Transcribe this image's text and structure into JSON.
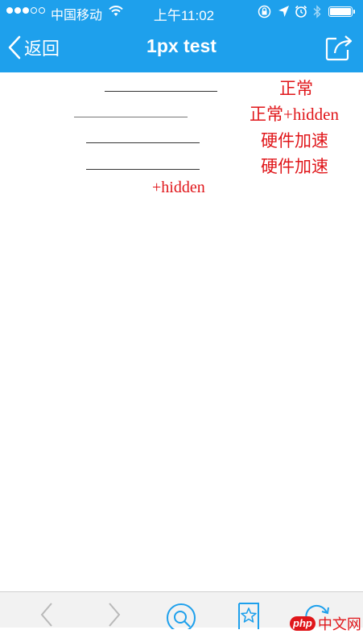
{
  "status_bar": {
    "carrier": "中国移动",
    "time": "上午11:02"
  },
  "nav": {
    "back_label": "返回",
    "title": "1px test"
  },
  "content": {
    "labels": [
      "正常",
      "正常+hidden",
      "硬件加速",
      "硬件加速",
      "+hidden"
    ]
  },
  "watermark": {
    "badge": "php",
    "text": "中文网"
  },
  "colors": {
    "header": "#1ea0ec",
    "label_red": "#e0161a",
    "toolbar_icon_blue": "#1ea0ec"
  },
  "icons": {
    "status": [
      "signal-dots",
      "wifi-icon",
      "orientation-lock-icon",
      "location-arrow-icon",
      "alarm-icon",
      "bluetooth-icon",
      "battery-icon"
    ],
    "nav": [
      "chevron-left-icon",
      "share-icon"
    ],
    "toolbar": [
      "back-arrow-icon",
      "forward-arrow-icon",
      "search-icon",
      "bookmark-star-icon",
      "refresh-icon"
    ]
  }
}
